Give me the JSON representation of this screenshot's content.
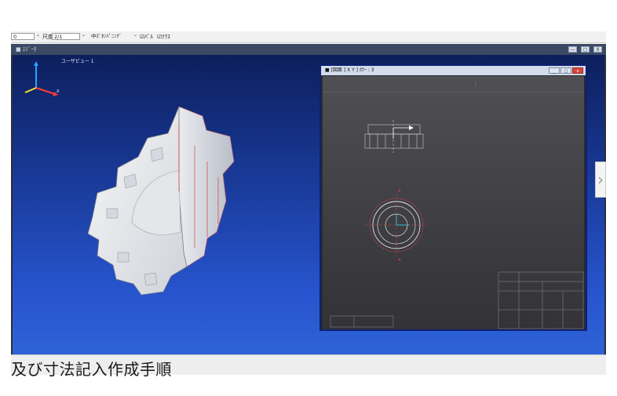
{
  "toolbar": {
    "combo1_value": "0",
    "scale_label": "尺度",
    "scale_value": "2/1",
    "mode_value": "中ﾎﾞﾀﾝﾊﾟﾆﾝｸﾞ",
    "check1_label": "☑ﾊﾟﾙ",
    "check2_label": "☑ﾅｸｽ"
  },
  "cad_window": {
    "title": "■ ｴﾃﾞｰﾀ",
    "min_label": "—",
    "max_label": "▢",
    "close_label": "X"
  },
  "viewport": {
    "view_label": "ユーザビュー 1"
  },
  "drawing_window": {
    "title": "■ [図面 ] X Y   ] ｶﾗｰ : 3",
    "min_label": "_",
    "max_label": "□",
    "close_label": "x"
  },
  "caption": "及び寸法記入作成手順",
  "colors": {
    "viewport_top": "#0d1f5d",
    "viewport_bottom": "#2f62d7",
    "drawing_bg": "#4a4a4f",
    "accent_red": "#d9473d"
  }
}
